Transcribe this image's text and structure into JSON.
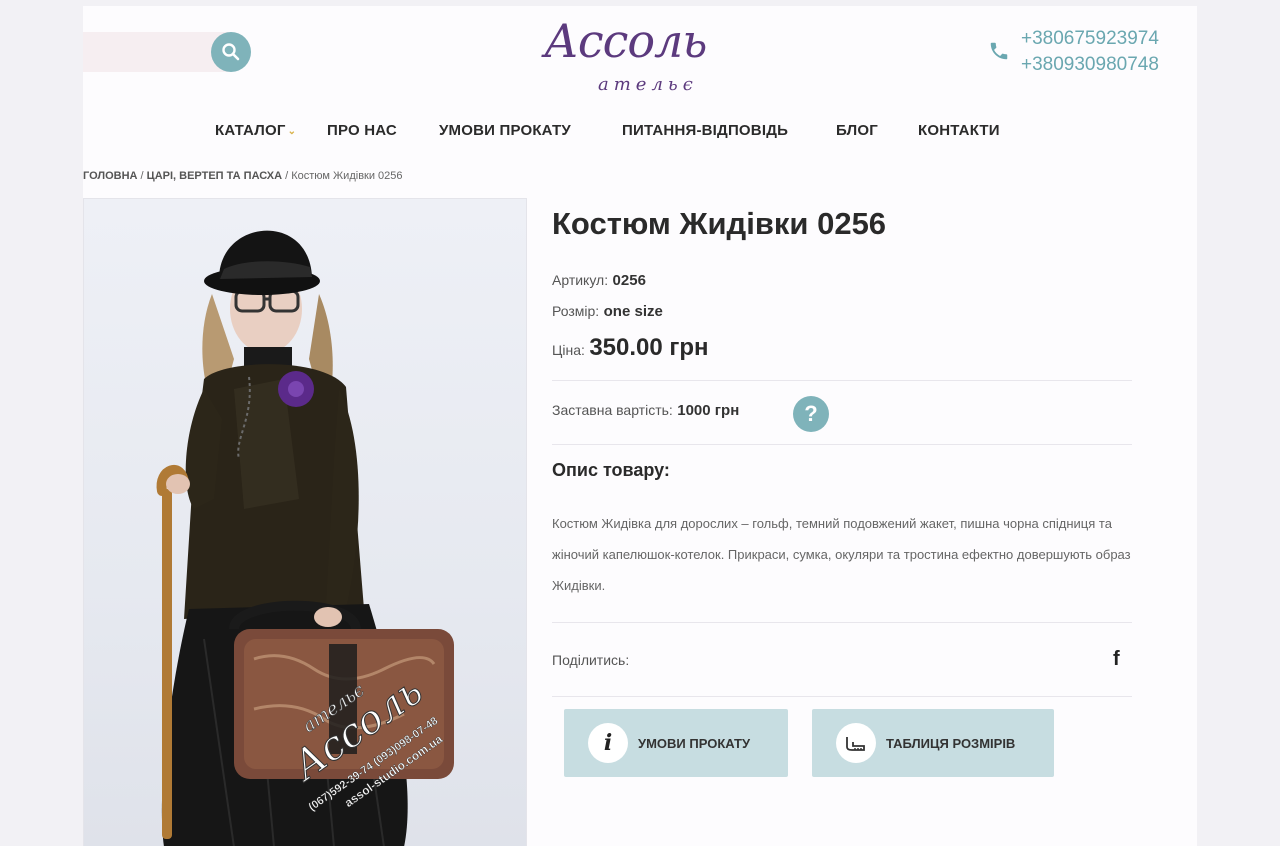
{
  "header": {
    "search": {
      "placeholder": "",
      "icon": "search-icon"
    },
    "logo": {
      "main": "Ассоль",
      "sub": "ательє"
    },
    "phones": [
      "+380675923974",
      "+380930980748"
    ],
    "phone_icon": "phone-icon"
  },
  "nav": {
    "items": [
      "КАТАЛОГ",
      "ПРО НАС",
      "УМОВИ ПРОКАТУ",
      "ПИТАННЯ-ВІДПОВІДЬ",
      "БЛОГ",
      "КОНТАКТИ"
    ]
  },
  "breadcrumb": {
    "home": "ГОЛОВНА",
    "category": "ЦАРІ, ВЕРТЕП ТА ПАСХА",
    "current": "Костюм Жидівки 0256",
    "separator": " / "
  },
  "image": {
    "watermark_brand": "Ассоль",
    "watermark_label": "ательє",
    "watermark_phones": "(067)592-39-74 (093)098-07-48",
    "watermark_site": "assol-studio.com.ua"
  },
  "product": {
    "title": "Костюм Жидівки 0256",
    "sku_label": "Артикул:",
    "sku_value": "0256",
    "size_label": "Розмір:",
    "size_value": "one size",
    "price_label": "Ціна:",
    "price_value": "350.00 грн",
    "deposit_label": "Заставна вартість:",
    "deposit_value": "1000 грн",
    "help_icon": "?",
    "description_heading": "Опис товару:",
    "description": "Костюм Жидівка для дорослих – гольф, темний подовжений жакет, пишна чорна спідниця та жіночий капелюшок-котелок. Прикраси, сумка, окуляри та тростина ефектно довершують образ Жидівки.",
    "share_label": "Поділитись:",
    "share_facebook": "f"
  },
  "actions": {
    "rental_terms": {
      "label": "УМОВИ ПРОКАТУ",
      "icon_text": "i"
    },
    "size_table": {
      "label": "ТАБЛИЦЯ РОЗМІРІВ",
      "icon": "measuring-icon"
    }
  },
  "colors": {
    "accent": "#7fb3ba",
    "brand": "#5c3a7e",
    "button_bg": "#c7dde1"
  }
}
